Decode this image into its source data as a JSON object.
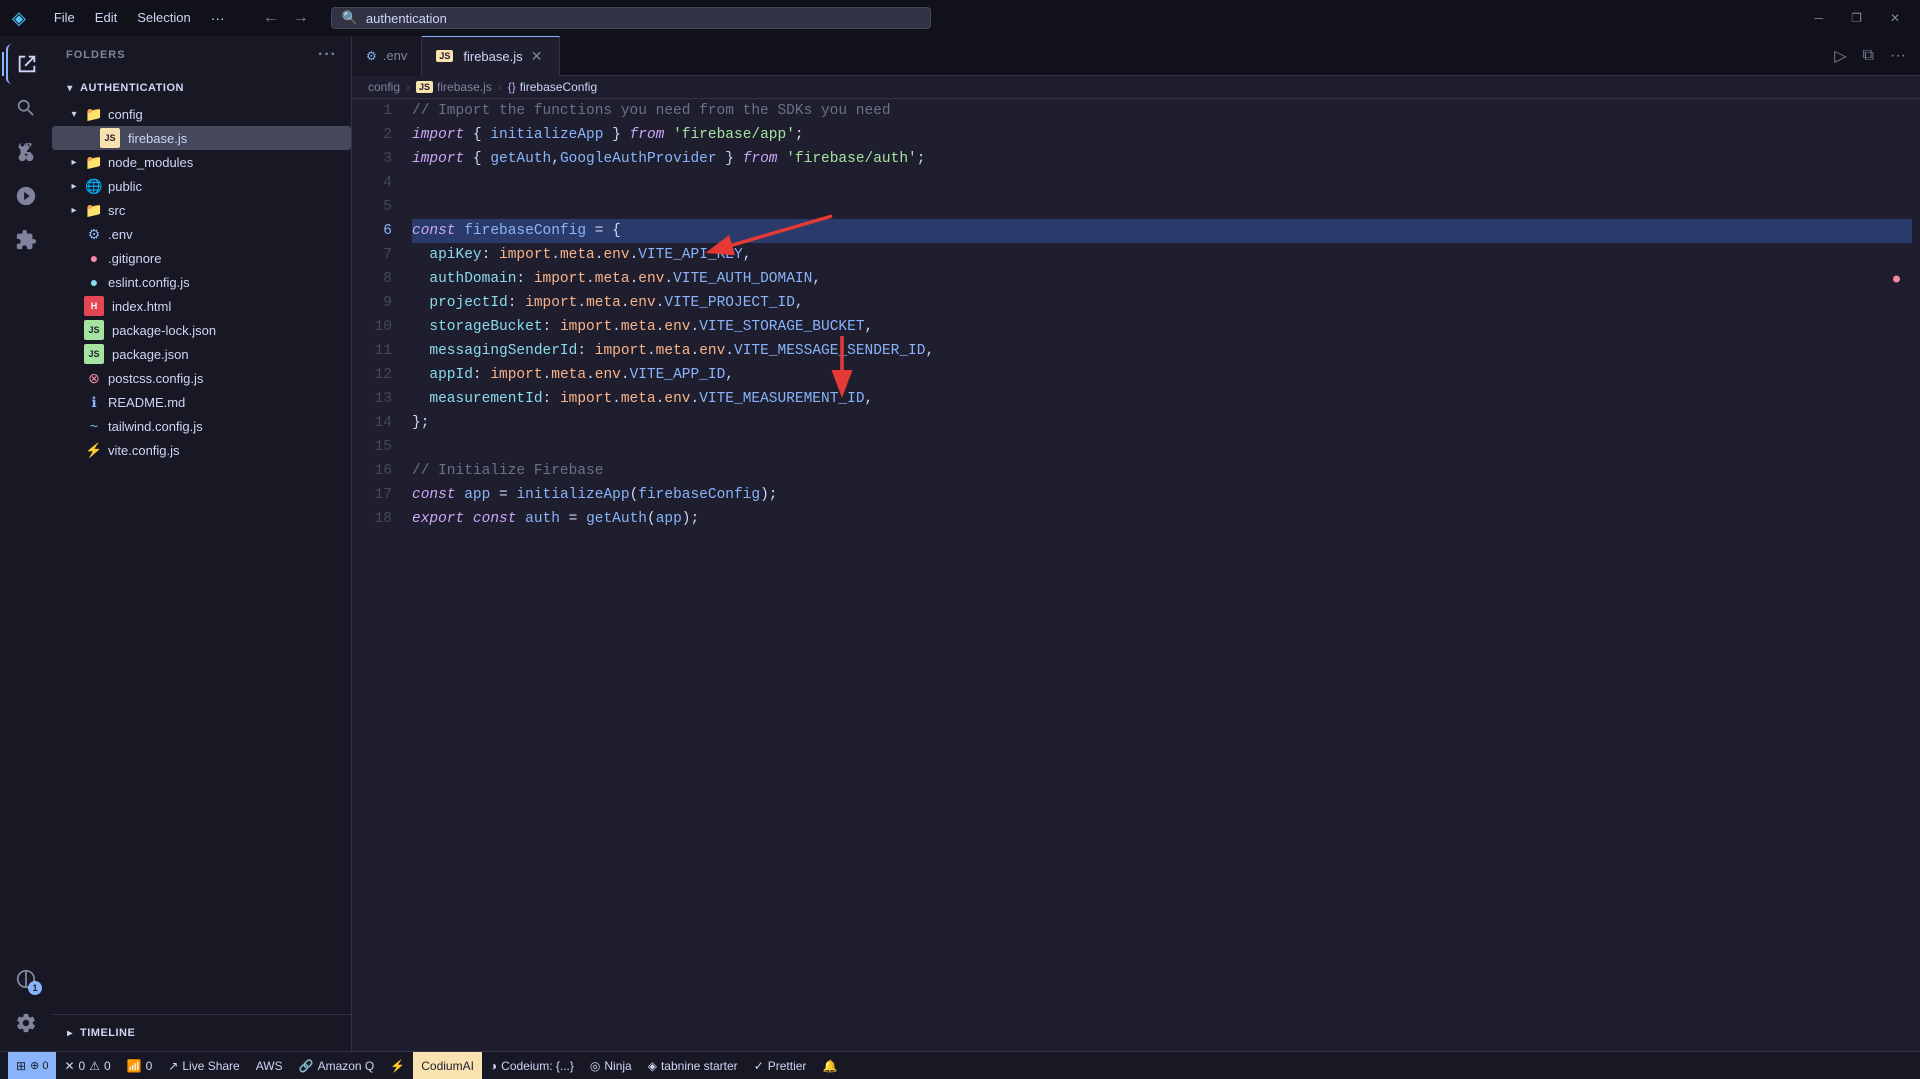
{
  "titlebar": {
    "logo": "◈",
    "menu": [
      "File",
      "Edit",
      "Selection",
      "···"
    ],
    "nav_back": "←",
    "nav_forward": "→",
    "search_placeholder": "authentication",
    "win_minimize": "─",
    "win_restore": "❐",
    "win_close": "✕"
  },
  "activity_bar": {
    "icons": [
      {
        "name": "explorer",
        "symbol": "⎘",
        "active": true
      },
      {
        "name": "search",
        "symbol": "🔍"
      },
      {
        "name": "source-control",
        "symbol": "⑂"
      },
      {
        "name": "run-debug",
        "symbol": "▷"
      },
      {
        "name": "extensions",
        "symbol": "⧉"
      }
    ],
    "bottom_icons": [
      {
        "name": "remote",
        "symbol": "⊞",
        "badge": "1"
      },
      {
        "name": "settings",
        "symbol": "⚙"
      }
    ]
  },
  "sidebar": {
    "header": "FOLDERS",
    "folders_label": "AUTHENTICATION",
    "tree": [
      {
        "id": "config",
        "label": "config",
        "type": "folder",
        "indent": 1,
        "expanded": true,
        "icon": "📁",
        "icon_color": "#89b4fa"
      },
      {
        "id": "firebase",
        "label": "firebase.js",
        "type": "file",
        "indent": 2,
        "icon": "JS",
        "icon_color": "#f9e2af",
        "active": true
      },
      {
        "id": "node_modules",
        "label": "node_modules",
        "type": "folder",
        "indent": 1,
        "icon": "📁",
        "icon_color": "#a6e3a1"
      },
      {
        "id": "public",
        "label": "public",
        "type": "folder",
        "indent": 1,
        "icon": "🌐",
        "icon_color": "#89dceb"
      },
      {
        "id": "src",
        "label": "src",
        "type": "folder",
        "indent": 1,
        "icon": "📁",
        "icon_color": "#a6e3a1"
      },
      {
        "id": "env",
        "label": ".env",
        "type": "file",
        "indent": 1,
        "icon": "⚙",
        "icon_color": "#89b4fa"
      },
      {
        "id": "gitignore",
        "label": ".gitignore",
        "type": "file",
        "indent": 1,
        "icon": "●",
        "icon_color": "#f38ba8"
      },
      {
        "id": "eslint",
        "label": "eslint.config.js",
        "type": "file",
        "indent": 1,
        "icon": "●",
        "icon_color": "#89dceb"
      },
      {
        "id": "index",
        "label": "index.html",
        "type": "file",
        "indent": 1,
        "icon": "H",
        "icon_color": "#e64553"
      },
      {
        "id": "pkglock",
        "label": "package-lock.json",
        "type": "file",
        "indent": 1,
        "icon": "JS",
        "icon_color": "#a6e3a1"
      },
      {
        "id": "pkg",
        "label": "package.json",
        "type": "file",
        "indent": 1,
        "icon": "JS",
        "icon_color": "#a6e3a1"
      },
      {
        "id": "postcss",
        "label": "postcss.config.js",
        "type": "file",
        "indent": 1,
        "icon": "⊗",
        "icon_color": "#f38ba8"
      },
      {
        "id": "readme",
        "label": "README.md",
        "type": "file",
        "indent": 1,
        "icon": "ℹ",
        "icon_color": "#89b4fa"
      },
      {
        "id": "tailwind",
        "label": "tailwind.config.js",
        "type": "file",
        "indent": 1,
        "icon": "~",
        "icon_color": "#74c7ec"
      },
      {
        "id": "vite",
        "label": "vite.config.js",
        "type": "file",
        "indent": 1,
        "icon": "⚡",
        "icon_color": "#f9e2af"
      }
    ],
    "timeline_label": "TIMELINE"
  },
  "tabs": [
    {
      "id": "env-tab",
      "label": ".env",
      "icon": "⚙",
      "icon_color": "#89b4fa",
      "active": false
    },
    {
      "id": "firebase-tab",
      "label": "firebase.js",
      "icon": "JS",
      "icon_color": "#f9e2af",
      "active": true,
      "closable": true
    }
  ],
  "breadcrumb": [
    {
      "label": "config"
    },
    {
      "label": "firebase.js",
      "icon": "JS"
    },
    {
      "label": "firebaseConfig",
      "icon": "{}"
    }
  ],
  "code": {
    "lines": [
      {
        "num": 1,
        "content": "// Import the functions you need from the SDKs you need",
        "type": "comment"
      },
      {
        "num": 2,
        "content": "import { initializeApp } from 'firebase/app';",
        "type": "import"
      },
      {
        "num": 3,
        "content": "import { getAuth,GoogleAuthProvider } from 'firebase/auth';",
        "type": "import"
      },
      {
        "num": 4,
        "content": "",
        "type": "blank"
      },
      {
        "num": 5,
        "content": "",
        "type": "blank"
      },
      {
        "num": 6,
        "content": "const firebaseConfig = {",
        "type": "code",
        "highlight": true
      },
      {
        "num": 7,
        "content": "  apiKey: import.meta.env.VITE_API_KEY,",
        "type": "code"
      },
      {
        "num": 8,
        "content": "  authDomain: import.meta.env.VITE_AUTH_DOMAIN,",
        "type": "code",
        "error": true
      },
      {
        "num": 9,
        "content": "  projectId: import.meta.env.VITE_PROJECT_ID,",
        "type": "code"
      },
      {
        "num": 10,
        "content": "  storageBucket: import.meta.env.VITE_STORAGE_BUCKET,",
        "type": "code"
      },
      {
        "num": 11,
        "content": "  messagingSenderId: import.meta.env.VITE_MESSAGE_SENDER_ID,",
        "type": "code"
      },
      {
        "num": 12,
        "content": "  appId: import.meta.env.VITE_APP_ID,",
        "type": "code"
      },
      {
        "num": 13,
        "content": "  measurementId: import.meta.env.VITE_MEASUREMENT_ID,",
        "type": "code"
      },
      {
        "num": 14,
        "content": "};",
        "type": "code"
      },
      {
        "num": 15,
        "content": "",
        "type": "blank"
      },
      {
        "num": 16,
        "content": "// Initialize Firebase",
        "type": "comment"
      },
      {
        "num": 17,
        "content": "const app = initializeApp(firebaseConfig);",
        "type": "code"
      },
      {
        "num": 18,
        "content": "export const auth = getAuth(app);",
        "type": "code"
      }
    ]
  },
  "statusbar": {
    "left_icon": "⊞",
    "errors": "0",
    "warnings": "0",
    "info": "0",
    "network": "0",
    "live_share": "Live Share",
    "aws": "AWS",
    "amazon_q": "Amazon Q",
    "lightning": "⚡",
    "codium_ai": "CodiumAI",
    "codeium": "Codeium: {...}",
    "ninja": "Ninja",
    "tabnine": "tabnine starter",
    "prettier": "Prettier",
    "bell": "🔔"
  }
}
